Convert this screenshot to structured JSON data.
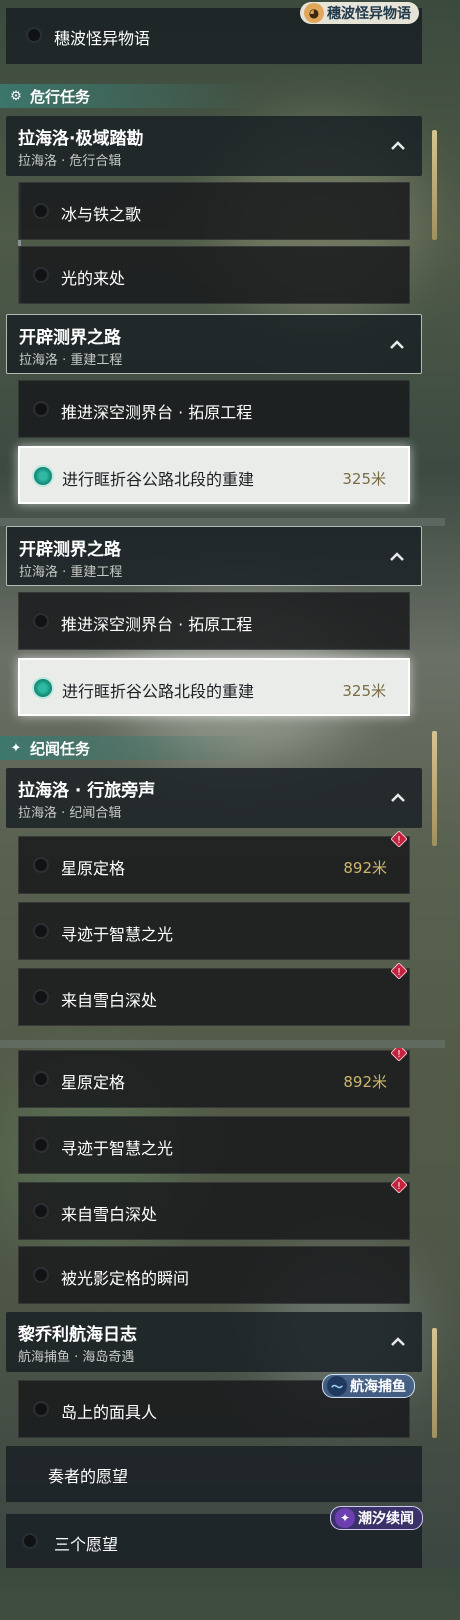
{
  "top_quest": {
    "label": "穗波怪异物语"
  },
  "badges": {
    "suibo": "穗波怪异物语",
    "hanghai": "航海捕鱼",
    "chaoxi": "潮汐续闻"
  },
  "section1": {
    "category": "危行任务",
    "group1": {
      "title": "拉海洛·极域踏勘",
      "subtitle": "拉海洛 · 危行合辑",
      "items": [
        {
          "label": "冰与铁之歌"
        },
        {
          "label": "光的来处"
        }
      ]
    },
    "group2": {
      "title": "开辟测界之路",
      "subtitle": "拉海洛 · 重建工程",
      "items": [
        {
          "label": "推进深空测界台 · 拓原工程"
        },
        {
          "label": "进行眶折谷公路北段的重建",
          "distance": "325米"
        }
      ]
    }
  },
  "section2": {
    "group": {
      "title": "开辟测界之路",
      "subtitle": "拉海洛 · 重建工程",
      "items": [
        {
          "label": "推进深空测界台 · 拓原工程"
        },
        {
          "label": "进行眶折谷公路北段的重建",
          "distance": "325米"
        }
      ]
    },
    "category": "纪闻任务",
    "group3": {
      "title": "拉海洛 · 行旅旁声",
      "subtitle": "拉海洛 · 纪闻合辑",
      "items": [
        {
          "label": "星原定格",
          "distance": "892米"
        },
        {
          "label": "寻迹于智慧之光"
        },
        {
          "label": "来自雪白深处"
        }
      ]
    }
  },
  "section3": {
    "items": [
      {
        "label": "星原定格",
        "distance": "892米"
      },
      {
        "label": "寻迹于智慧之光"
      },
      {
        "label": "来自雪白深处"
      },
      {
        "label": "被光影定格的瞬间"
      }
    ],
    "group": {
      "title": "黎乔利航海日志",
      "subtitle": "航海捕鱼 · 海岛奇遇",
      "items": [
        {
          "label": "岛上的面具人"
        }
      ]
    },
    "extra": [
      {
        "label": "奏者的愿望"
      },
      {
        "label": "三个愿望"
      }
    ]
  },
  "colors": {
    "accent": "#3a7a70",
    "distance": "#cdb56c",
    "alert": "#c4213e"
  }
}
